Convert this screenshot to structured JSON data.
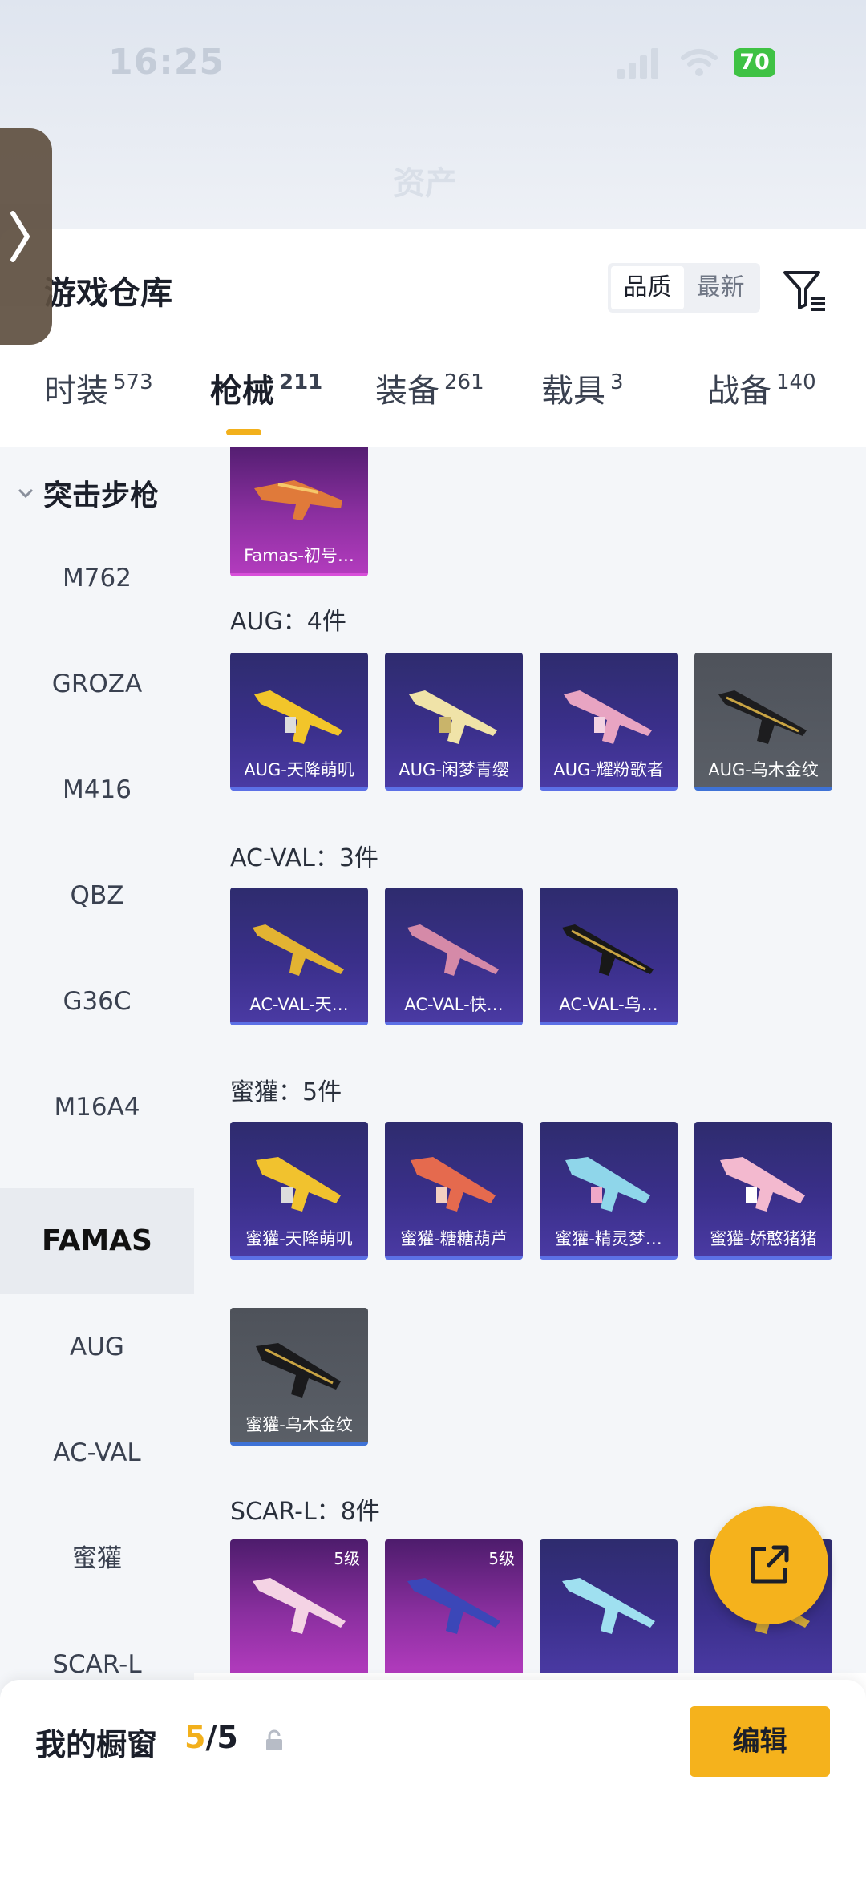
{
  "status_bar": {
    "time": "16:25",
    "battery": "70"
  },
  "header": {
    "title": "资产"
  },
  "page_title": "游戏仓库",
  "sort": {
    "options": [
      "品质",
      "最新"
    ],
    "active": "品质"
  },
  "tabs": [
    {
      "label": "时装",
      "count": "573"
    },
    {
      "label": "枪械",
      "count": "211",
      "active": true
    },
    {
      "label": "装备",
      "count": "261"
    },
    {
      "label": "载具",
      "count": "3"
    },
    {
      "label": "战备",
      "count": "140"
    }
  ],
  "sidenav": {
    "category": "突击步枪",
    "items": [
      "M762",
      "GROZA",
      "M416",
      "QBZ",
      "G36C",
      "M16A4",
      "FAMAS",
      "AUG",
      "AC-VAL",
      "蜜獾",
      "SCAR-L"
    ],
    "active": "FAMAS"
  },
  "groups": [
    {
      "label": "",
      "items": [
        {
          "name": "Famas-初号…",
          "rarity": "purple"
        }
      ]
    },
    {
      "label": "AUG：4件",
      "items": [
        {
          "name": "AUG-天降萌叽",
          "rarity": "blue"
        },
        {
          "name": "AUG-闲梦青缨",
          "rarity": "blue"
        },
        {
          "name": "AUG-耀粉歌者",
          "rarity": "blue"
        },
        {
          "name": "AUG-乌木金纹",
          "rarity": "gray"
        }
      ]
    },
    {
      "label": "AC-VAL：3件",
      "items": [
        {
          "name": "AC-VAL-天…",
          "rarity": "blue"
        },
        {
          "name": "AC-VAL-快…",
          "rarity": "blue"
        },
        {
          "name": "AC-VAL-乌…",
          "rarity": "blue"
        }
      ]
    },
    {
      "label": "蜜獾：5件",
      "items": [
        {
          "name": "蜜獾-天降萌叽",
          "rarity": "blue"
        },
        {
          "name": "蜜獾-糖糖葫芦",
          "rarity": "blue"
        },
        {
          "name": "蜜獾-精灵梦…",
          "rarity": "blue"
        },
        {
          "name": "蜜獾-娇憨猪猪",
          "rarity": "blue"
        },
        {
          "name": "蜜獾-乌木金纹",
          "rarity": "gray"
        }
      ]
    },
    {
      "label": "SCAR-L：8件",
      "items": [
        {
          "name": "",
          "rarity": "purple",
          "level": "5级"
        },
        {
          "name": "",
          "rarity": "purple",
          "level": "5级"
        },
        {
          "name": "",
          "rarity": "blue"
        },
        {
          "name": "",
          "rarity": "blue"
        }
      ]
    }
  ],
  "bottom_bar": {
    "title": "我的橱窗",
    "current": "5",
    "total": "/5",
    "edit_label": "编辑"
  },
  "colors": {
    "accent": "#f5b21c",
    "blue_card": "#3a2f8a",
    "purple_card": "#8a2f9f",
    "gray_card": "#555a62"
  }
}
